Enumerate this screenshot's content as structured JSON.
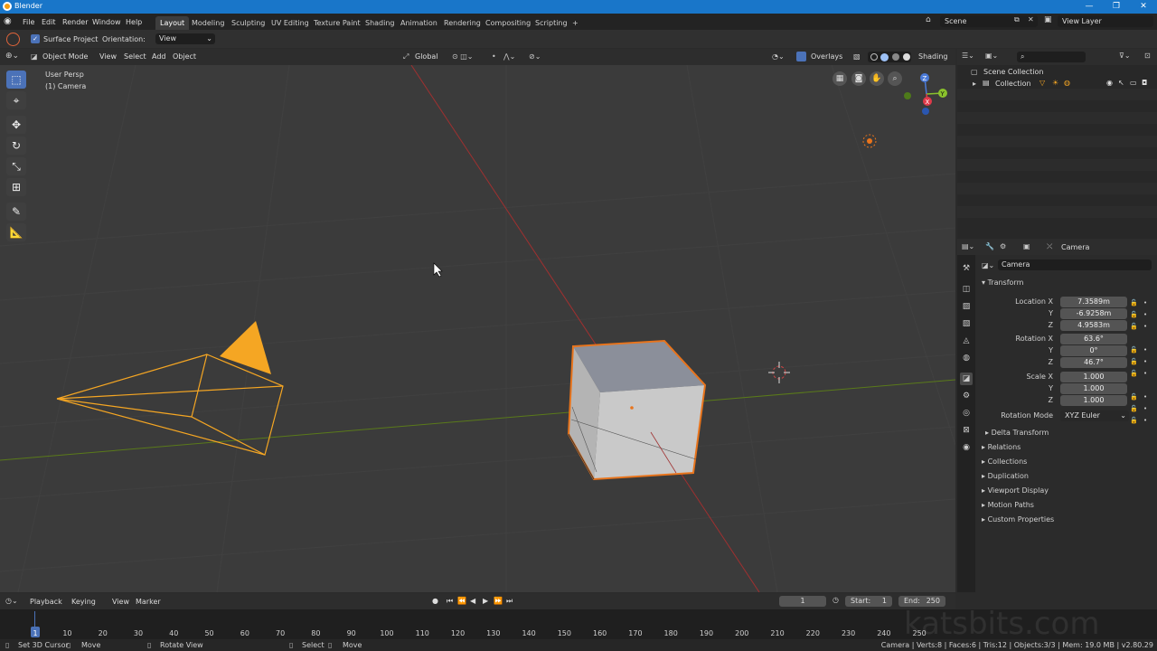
{
  "window": {
    "title": "Blender"
  },
  "menu": [
    "File",
    "Edit",
    "Render",
    "Window",
    "Help"
  ],
  "workspaces": [
    "Layout",
    "Modeling",
    "Sculpting",
    "UV Editing",
    "Texture Paint",
    "Shading",
    "Animation",
    "Rendering",
    "Compositing",
    "Scripting",
    "+"
  ],
  "scene": {
    "name": "Scene",
    "view_layer": "View Layer"
  },
  "tool_settings": {
    "surface_project": "Surface Project",
    "orientation_label": "Orientation:",
    "orientation_value": "View"
  },
  "viewport_header": {
    "mode": "Object Mode",
    "menus": [
      "View",
      "Select",
      "Add",
      "Object"
    ],
    "transform": "Global",
    "overlays": "Overlays",
    "shading": "Shading"
  },
  "viewport": {
    "perspective": "User Persp",
    "active_object": "(1) Camera"
  },
  "outliner": {
    "root": "Scene Collection",
    "collection": "Collection"
  },
  "properties": {
    "context": "Camera",
    "object_name": "Camera",
    "transform_title": "Transform",
    "location": {
      "label": "Location X",
      "x": "7.3589m",
      "y": "-6.9258m",
      "z": "4.9583m"
    },
    "rotation": {
      "label": "Rotation X",
      "x": "63.6°",
      "y": "0°",
      "z": "46.7°"
    },
    "scale": {
      "label": "Scale X",
      "x": "1.000",
      "y": "1.000",
      "z": "1.000"
    },
    "axis_y": "Y",
    "axis_z": "Z",
    "rotation_mode_label": "Rotation Mode",
    "rotation_mode": "XYZ Euler",
    "delta": "Delta Transform",
    "sections": [
      "Relations",
      "Collections",
      "Duplication",
      "Viewport Display",
      "Motion Paths",
      "Custom Properties"
    ]
  },
  "timeline": {
    "menus": [
      "Playback",
      "Keying",
      "View",
      "Marker"
    ],
    "current_frame": "1",
    "start_label": "Start:",
    "start": "1",
    "end_label": "End:",
    "end": "250",
    "ticks": [
      "1",
      "10",
      "20",
      "30",
      "40",
      "50",
      "60",
      "70",
      "80",
      "90",
      "100",
      "110",
      "120",
      "130",
      "140",
      "150",
      "160",
      "170",
      "180",
      "190",
      "200",
      "210",
      "220",
      "230",
      "240",
      "250"
    ]
  },
  "statusbar": {
    "left": [
      "Set 3D Cursor",
      "Move",
      "Rotate View"
    ],
    "mid": [
      "Select",
      "Move"
    ],
    "info": "Camera | Verts:8 | Faces:6 | Tris:12 | Objects:3/3 | Mem: 19.0 MB | v2.80.29"
  },
  "watermark": "katsbits.com",
  "colors": {
    "accent": "#4b72b8",
    "selection": "#f5a623",
    "active_outline": "#e8741c",
    "x_axis": "#a03030",
    "y_axis": "#5a7a1a"
  }
}
